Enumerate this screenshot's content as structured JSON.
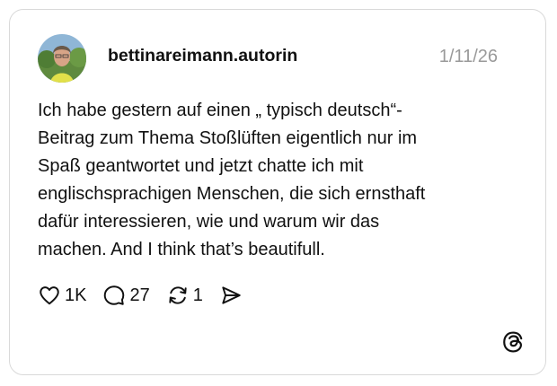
{
  "post": {
    "username": "bettinareimann.autorin",
    "date": "1/11/26",
    "body_lines": [
      "Ich habe gestern auf einen „ typisch deutsch“-",
      "Beitrag zum Thema Stoßlüften eigentlich nur im",
      "Spaß geantwortet und jetzt chatte ich mit",
      "englischsprachigen Menschen, die sich ernsthaft",
      "dafür interessieren, wie und warum wir das",
      "machen. And I think that’s beautifull."
    ]
  },
  "actions": {
    "like": {
      "icon": "heart-icon",
      "count": "1K"
    },
    "comment": {
      "icon": "comment-bubble-icon",
      "count": "27"
    },
    "repost": {
      "icon": "repost-icon",
      "count": "1"
    },
    "share": {
      "icon": "send-icon"
    }
  },
  "brand": {
    "icon": "threads-logo-icon"
  },
  "colors": {
    "card_border": "#d9d9d9",
    "text": "#111111",
    "date": "#9a9a9a"
  }
}
